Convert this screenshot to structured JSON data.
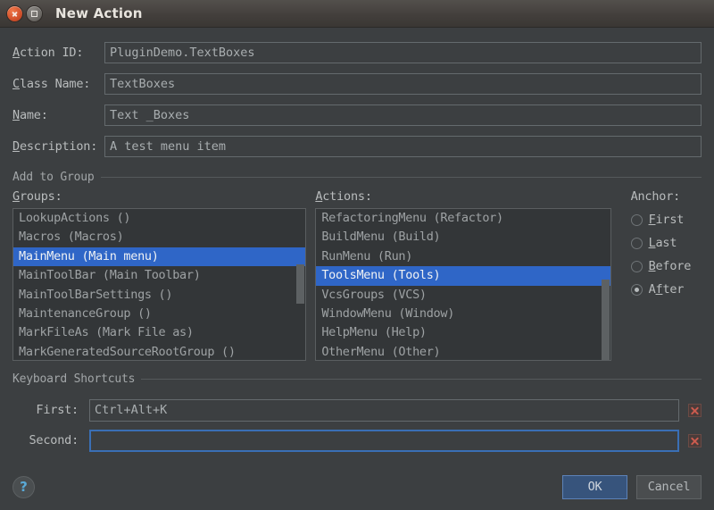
{
  "window": {
    "title": "New Action",
    "close_icon": "close-icon",
    "maximize_icon": "maximize-icon"
  },
  "form": {
    "fields": [
      {
        "label_pre": "A",
        "label_post": "ction ID:",
        "value": "PluginDemo.TextBoxes",
        "name": "action-id"
      },
      {
        "label_pre": "C",
        "label_post": "lass Name:",
        "value": "TextBoxes",
        "name": "class-name"
      },
      {
        "label_pre": "N",
        "label_post": "ame:",
        "value": "Text _Boxes",
        "name": "name"
      },
      {
        "label_pre": "D",
        "label_post": "escription:",
        "value": "A test menu item",
        "name": "description"
      }
    ]
  },
  "add_to_group": {
    "section_label": "Add to Group",
    "groups": {
      "label_pre": "G",
      "label_post": "roups:",
      "items": [
        "LookupActions ()",
        "Macros (Macros)",
        "MainMenu (Main menu)",
        "MainToolBar (Main Toolbar)",
        "MainToolBarSettings ()",
        "MaintenanceGroup ()",
        "MarkFileAs (Mark File as)",
        "MarkGeneratedSourceRootGroup ()"
      ],
      "selected_index": 2
    },
    "actions": {
      "label_pre": "A",
      "label_post": "ctions:",
      "items": [
        "RefactoringMenu (Refactor)",
        "BuildMenu (Build)",
        "RunMenu (Run)",
        "ToolsMenu (Tools)",
        "VcsGroups (VCS)",
        "WindowMenu (Window)",
        "HelpMenu (Help)",
        "OtherMenu (Other)"
      ],
      "selected_index": 3
    },
    "anchor": {
      "label": "Anchor:",
      "options": [
        {
          "pre": "",
          "mn": "F",
          "post": "irst",
          "selected": false
        },
        {
          "pre": "",
          "mn": "L",
          "post": "ast",
          "selected": false
        },
        {
          "pre": "",
          "mn": "B",
          "post": "efore",
          "selected": false
        },
        {
          "pre": "A",
          "mn": "f",
          "post": "ter",
          "selected": true
        }
      ]
    }
  },
  "keyboard_shortcuts": {
    "section_label": "Keyboard Shortcuts",
    "rows": [
      {
        "label": "First:",
        "value": "Ctrl+Alt+K",
        "focused": false,
        "name": "first-shortcut"
      },
      {
        "label": "Second:",
        "value": "",
        "focused": true,
        "name": "second-shortcut"
      }
    ],
    "delete_icon": "delete-x-icon"
  },
  "footer": {
    "help_label": "?",
    "ok_label": "OK",
    "cancel_label": "Cancel"
  },
  "colors": {
    "dialog_bg": "#3c3f41",
    "list_bg": "#333638",
    "selection": "#2f66c7",
    "accent_ok": "#37547c",
    "delete_x": "#cc5b4e",
    "help_blue": "#5aa9d6"
  }
}
